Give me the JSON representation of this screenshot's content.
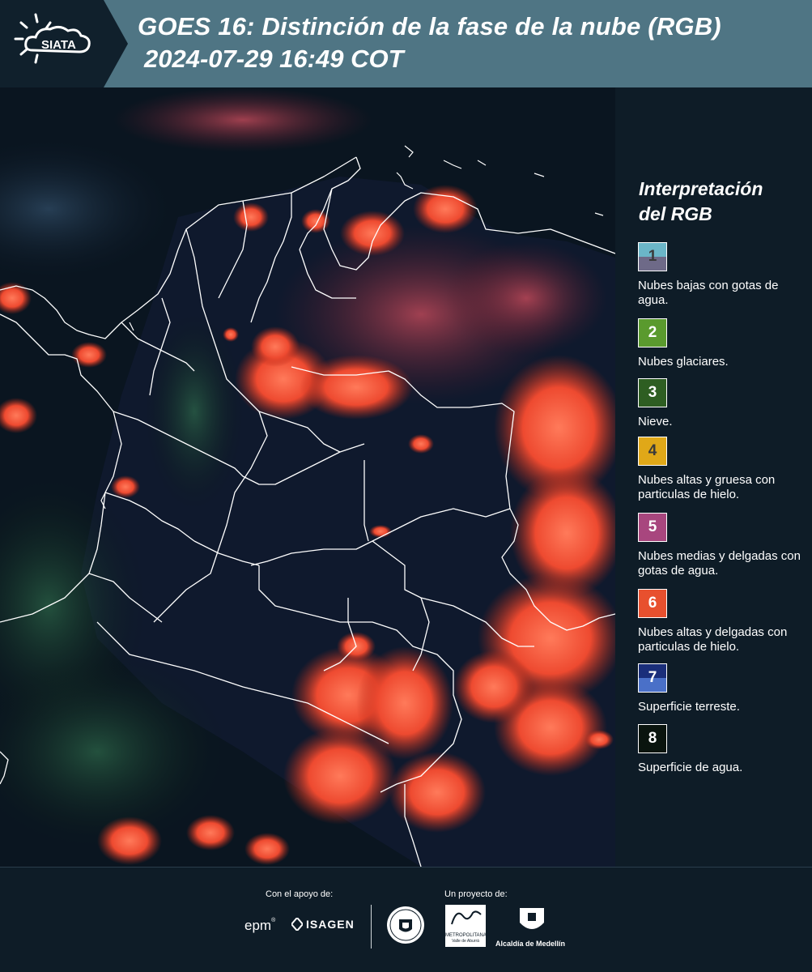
{
  "header": {
    "logo_text": "SIATA",
    "title": "GOES 16: Distinción de la fase de la nube (RGB)",
    "datetime": "2024-07-29 16:49 COT",
    "background_color": "#4f7584"
  },
  "legend": {
    "title_line1": "Interpretación",
    "title_line2": "del RGB",
    "items": [
      {
        "number": "1",
        "label": "Nubes bajas con gotas de agua.",
        "color_top": "#6bb6c8",
        "color_bottom": "#6e6a88"
      },
      {
        "number": "2",
        "label": "Nubes glaciares.",
        "color_top": "#5a9a2e",
        "color_bottom": "#5a9a2e"
      },
      {
        "number": "3",
        "label": "Nieve.",
        "color_top": "#2e5e22",
        "color_bottom": "#2e5e22"
      },
      {
        "number": "4",
        "label": "Nubes altas y gruesa con particulas de hielo.",
        "color_top": "#e0a818",
        "color_bottom": "#e0a818"
      },
      {
        "number": "5",
        "label": "Nubes medias y delgadas con gotas de agua.",
        "color_top": "#a8467e",
        "color_bottom": "#a8467e"
      },
      {
        "number": "6",
        "label": "Nubes altas y delgadas con particulas de hielo.",
        "color_top": "#e8502e",
        "color_bottom": "#e8502e"
      },
      {
        "number": "7",
        "label": "Superficie terreste.",
        "color_top": "#1a2e7a",
        "color_bottom": "#4a70c8"
      },
      {
        "number": "8",
        "label": "Superficie de agua.",
        "color_top": "#0a140e",
        "color_bottom": "#0a140e"
      }
    ]
  },
  "footer": {
    "support_label": "Con el apoyo de:",
    "project_label": "Un proyecto de:",
    "partners": {
      "epm": "epm",
      "isagen": "ISAGEN",
      "area_line1": "METROPOLITANA",
      "area_line2": "Valle de Aburrá",
      "alcaldia": "Alcaldía de Medellín"
    }
  }
}
